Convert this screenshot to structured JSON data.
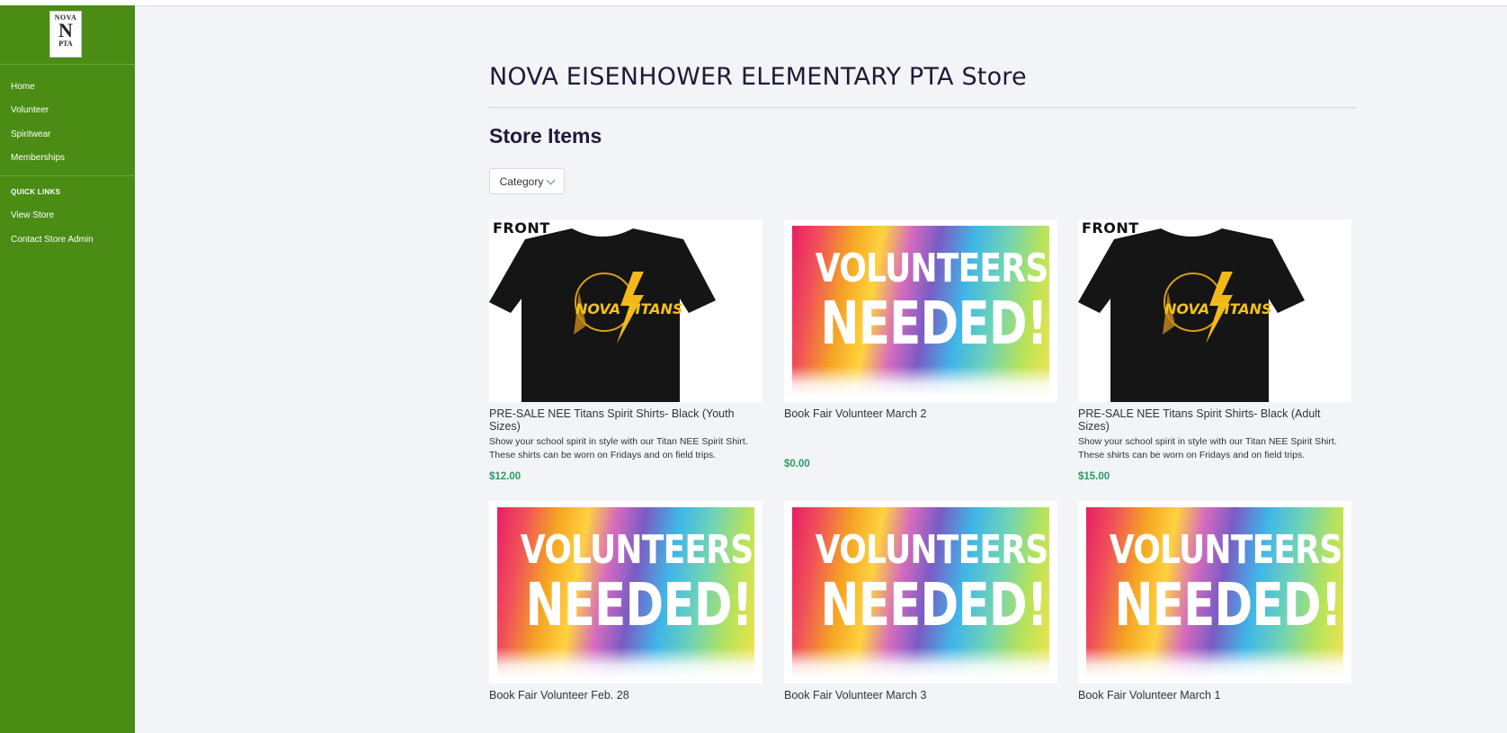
{
  "sidebar": {
    "logo": {
      "top": "NOVA",
      "mark": "N",
      "bottom": "PTA"
    },
    "nav": [
      {
        "label": "Home"
      },
      {
        "label": "Volunteer"
      },
      {
        "label": "Spiritwear"
      },
      {
        "label": "Memberships"
      }
    ],
    "quick_links_heading": "QUICK LINKS",
    "quick_links": [
      {
        "label": "View Store"
      },
      {
        "label": "Contact Store Admin"
      }
    ],
    "background": "#4a8c14"
  },
  "main": {
    "store_title": "NOVA EISENHOWER ELEMENTARY PTA Store",
    "section_title": "Store Items",
    "category_button": "Category",
    "products": [
      {
        "name": "PRE-SALE NEE Titans Spirit Shirts- Black (Youth Sizes)",
        "description": "Show your school spirit in style with our Titan NEE  Spirit Shirt. These shirts can be worn on Fridays and on field trips.",
        "price": "$12.00",
        "image": "shirt",
        "image_label": "FRONT",
        "shirt_text": "NOVA TITANS"
      },
      {
        "name": "Book Fair Volunteer March 2",
        "description": "",
        "price": "$0.00",
        "image": "volunteer",
        "banner_line1": "VOLUNTEERS",
        "banner_line2": "NEEDED!"
      },
      {
        "name": "PRE-SALE NEE Titans Spirit Shirts- Black (Adult Sizes)",
        "description": "Show your school spirit in style with our Titan NEE  Spirit Shirt. These shirts can be worn on Fridays and on field trips.",
        "price": "$15.00",
        "image": "shirt",
        "image_label": "FRONT",
        "shirt_text": "NOVA TITANS"
      },
      {
        "name": "Book Fair Volunteer Feb. 28",
        "description": "",
        "price": "",
        "image": "volunteer",
        "banner_line1": "VOLUNTEERS",
        "banner_line2": "NEEDED!"
      },
      {
        "name": "Book Fair Volunteer March 3",
        "description": "",
        "price": "",
        "image": "volunteer",
        "banner_line1": "VOLUNTEERS",
        "banner_line2": "NEEDED!"
      },
      {
        "name": "Book Fair Volunteer March 1",
        "description": "",
        "price": "",
        "image": "volunteer",
        "banner_line1": "VOLUNTEERS",
        "banner_line2": "NEEDED!"
      }
    ],
    "accent_price_color": "#2a9a63"
  }
}
